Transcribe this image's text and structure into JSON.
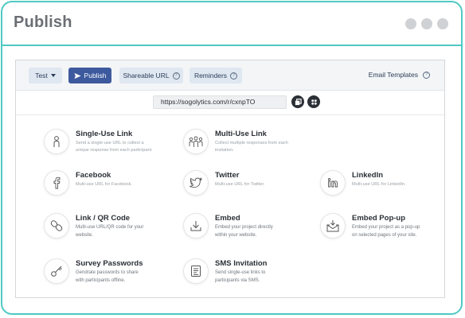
{
  "window": {
    "title": "Publish"
  },
  "toolbar": {
    "test_label": "Test",
    "publish_label": "Publish",
    "shareable_label": "Shareable URL",
    "reminders_label": "Reminders",
    "email_templates_label": "Email Templates",
    "help_glyph": "?"
  },
  "url": {
    "value": "https://sogolytics.com/r/cxnpTO"
  },
  "options": {
    "single_use": {
      "title": "Single-Use Link",
      "desc1": "Send a single-use URL to collect a",
      "desc2": "unique response from each participant."
    },
    "multi_use": {
      "title": "Multi-Use Link",
      "desc1": "Collect multiple responses from each",
      "desc2": "invitation."
    },
    "facebook": {
      "title": "Facebook",
      "desc1": "Multi-use URL for Facebook."
    },
    "twitter": {
      "title": "Twitter",
      "desc1": "Multi-use URL for Twitter."
    },
    "linkedin": {
      "title": "LinkedIn",
      "desc1": "Multi-use URL for LinkedIn."
    },
    "link_qr": {
      "title": "Link / QR Code",
      "desc1": "Multi-use URL/QR code for your",
      "desc2": "website."
    },
    "embed": {
      "title": "Embed",
      "desc1": "Embed your project directly",
      "desc2": "within your website."
    },
    "embed_popup": {
      "title": "Embed Pop-up",
      "desc1": "Embed your project as a pop-up",
      "desc2": "on selected pages of your site."
    },
    "survey_passwords": {
      "title": "Survey Passwords",
      "desc1": "Gendrate passwords to share",
      "desc2": "with participants offline."
    },
    "sms": {
      "title": "SMS Invitation",
      "desc1": "Send single-use links to",
      "desc2": "participants via SMS."
    }
  },
  "colors": {
    "frame": "#4fc9c3",
    "primary_button": "#3d5a9e",
    "secondary_button": "#dfe7f1"
  },
  "icons": [
    "person-icon",
    "group-icon",
    "facebook-icon",
    "twitter-icon",
    "linkedin-icon",
    "link-icon",
    "download-icon",
    "mail-popup-icon",
    "key-icon",
    "sms-icon",
    "copy-icon",
    "qr-icon",
    "send-icon",
    "caret-down-icon",
    "help-icon"
  ]
}
